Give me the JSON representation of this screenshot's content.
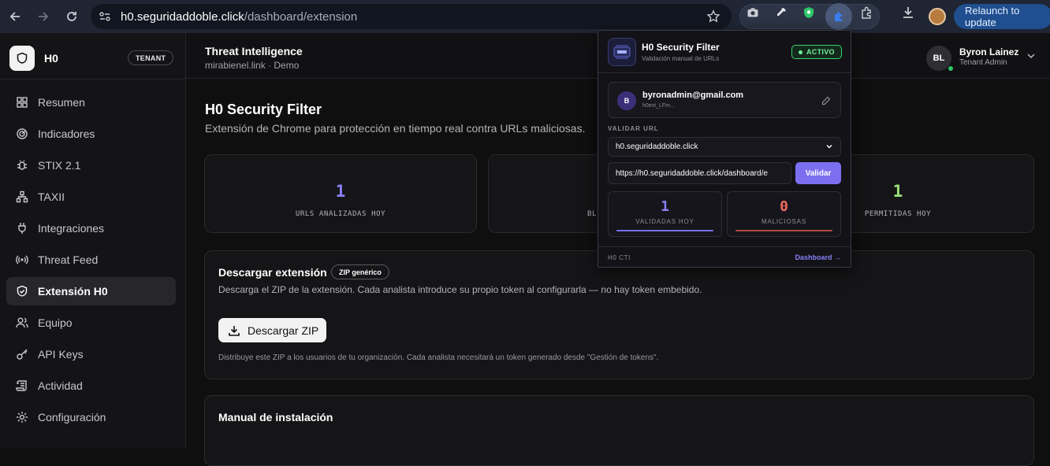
{
  "browser": {
    "url_host": "h0.seguridaddoble.click",
    "url_path": "/dashboard/extension",
    "relaunch_label": "Relaunch to update"
  },
  "sidebar": {
    "brand": "H0",
    "tenant_badge": "TENANT",
    "items": [
      {
        "label": "Resumen",
        "icon": "grid-icon",
        "active": false
      },
      {
        "label": "Indicadores",
        "icon": "radar-icon",
        "active": false
      },
      {
        "label": "STIX 2.1",
        "icon": "bug-icon",
        "active": false
      },
      {
        "label": "TAXII",
        "icon": "network-icon",
        "active": false
      },
      {
        "label": "Integraciones",
        "icon": "plug-icon",
        "active": false
      },
      {
        "label": "Threat Feed",
        "icon": "broadcast-icon",
        "active": false
      },
      {
        "label": "Extensión H0",
        "icon": "shield-icon",
        "active": true
      },
      {
        "label": "Equipo",
        "icon": "users-icon",
        "active": false
      },
      {
        "label": "API Keys",
        "icon": "key-icon",
        "active": false
      },
      {
        "label": "Actividad",
        "icon": "scroll-icon",
        "active": false
      },
      {
        "label": "Configuración",
        "icon": "gear-icon",
        "active": false
      }
    ]
  },
  "header": {
    "title": "Threat Intelligence",
    "subtitle": "mirabienel.link · Demo",
    "user_initials": "BL",
    "user_name": "Byron Lainez",
    "user_role": "Tenant Admin"
  },
  "main": {
    "title": "H0 Security Filter",
    "subtitle": "Extensión de Chrome para protección en tiempo real contra URLs maliciosas.",
    "stats": [
      {
        "value": "1",
        "label": "URLS ANALIZADAS HOY",
        "color": "#8b7ff5"
      },
      {
        "value": "",
        "label": "BL",
        "color": "#e8e8ea"
      },
      {
        "value": "1",
        "label": "PERMITIDAS HOY",
        "color": "#9be07a"
      }
    ],
    "download": {
      "title": "Descargar extensión",
      "badge": "ZIP genérico",
      "description": "Descarga el ZIP de la extensión. Cada analista introduce su propio token al configurarla — no hay token embebido.",
      "button": "Descargar ZIP",
      "note": "Distribuye este ZIP a los usuarios de tu organización. Cada analista necesitará un token generado desde \"Gestión de tokens\"."
    },
    "manual": {
      "title": "Manual de instalación"
    }
  },
  "popup": {
    "title": "H0 Security Filter",
    "subtitle": "Validación manual de URLs",
    "status": "ACTIVO",
    "account_initial": "B",
    "account_email": "byronadmin@gmail.com",
    "account_token": "h0ext_LFm...",
    "section_label": "VALIDAR URL",
    "selected_host": "h0.seguridaddoble.click",
    "url_value": "https://h0.seguridaddoble.click/dashboard/e",
    "validate_button": "Validar",
    "validated_value": "1",
    "validated_label": "VALIDADAS HOY",
    "malicious_value": "0",
    "malicious_label": "MALICIOSAS",
    "footer_left": "H0 CTI",
    "footer_right": "Dashboard →"
  },
  "colors": {
    "accent": "#8b7ff5",
    "ok": "#9be07a",
    "danger": "#f26b5b",
    "active_green": "#6ef29a"
  }
}
